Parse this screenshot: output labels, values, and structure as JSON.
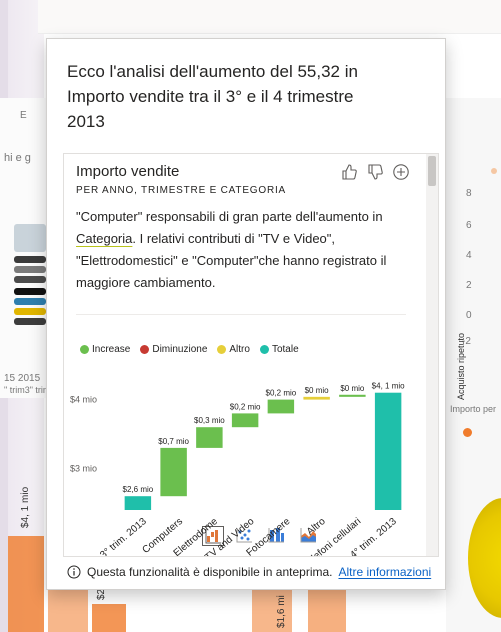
{
  "background": {
    "truncated_text_1": "E",
    "truncated_text_2": "hi e g",
    "quarter_labels": "15   2015",
    "quarter_sub": "\" trim3\" trim",
    "right_axis_label": "Acquisto ripetuto",
    "right_ticks": [
      "8",
      "6",
      "4",
      "2",
      "0",
      "-2"
    ],
    "right_x_label": "Importo per",
    "bar_label_1": "$4, 1 mio",
    "bar_label_2": "$2",
    "bar_label_3": "$1,6 mi"
  },
  "flyout": {
    "title": "Ecco l'analisi dell'aumento del 55,32 in Importo vendite tra il 3° e il 4 trimestre 2013",
    "card": {
      "title": "Importo vendite",
      "subtitle": "PER ANNO, TRIMESTRE E CATEGORIA",
      "explain_before": "\"Computer\" responsabili di gran parte dell'aumento in ",
      "explain_highlight": "Categoria",
      "explain_after": ". I relativi contributi di \"TV e Video\", \"Elettrodomestici\" e \"Computer\"che hanno registrato il maggiore cambiamento.",
      "icons": [
        "thumbs-up-icon",
        "thumbs-down-icon",
        "plus-circle-icon"
      ],
      "visual_types": [
        "waterfall-icon",
        "scatter-icon",
        "column-icon",
        "area-icon"
      ]
    },
    "preview_text": "Questa funzionalità è disponibile in anteprima.",
    "preview_link": "Altre informazioni"
  },
  "chart_data": {
    "type": "bar",
    "subtype": "waterfall",
    "legend": [
      {
        "name": "Increase",
        "color": "#6bbf4e"
      },
      {
        "name": "Diminuzione",
        "color": "#c73a32"
      },
      {
        "name": "Altro",
        "color": "#e6cf3a"
      },
      {
        "name": "Totale",
        "color": "#1fbfaa"
      }
    ],
    "y_ticks": [
      "$4 mio",
      "$3 mio"
    ],
    "y_tick_values": [
      4.0,
      3.0
    ],
    "categories": [
      "3° trim. 2013",
      "Computers",
      "Elettrodome",
      "TV and Video",
      "Fotocamere",
      "Altro",
      "Telefoni cellulari",
      "4° trim. 2013"
    ],
    "bars": [
      {
        "category": "3° trim. 2013",
        "kind": "total",
        "value": 2.6,
        "label": "$2,6 mio"
      },
      {
        "category": "Computers",
        "kind": "increase",
        "value": 0.7,
        "label": "$0,7 mio"
      },
      {
        "category": "Elettrodome",
        "kind": "increase",
        "value": 0.3,
        "label": "$0,3 mio"
      },
      {
        "category": "TV and Video",
        "kind": "increase",
        "value": 0.2,
        "label": "$0,2 mio"
      },
      {
        "category": "Fotocamere",
        "kind": "increase",
        "value": 0.2,
        "label": "$0,2 mio"
      },
      {
        "category": "Altro",
        "kind": "other",
        "value": 0.04,
        "label": "$0 mio"
      },
      {
        "category": "Telefoni cellulari",
        "kind": "increase",
        "value": 0.03,
        "label": "$0 mio"
      },
      {
        "category": "4° trim. 2013",
        "kind": "total",
        "value": 4.1,
        "label": "$4, 1 mio"
      }
    ],
    "ylim": [
      2.4,
      4.4
    ]
  }
}
